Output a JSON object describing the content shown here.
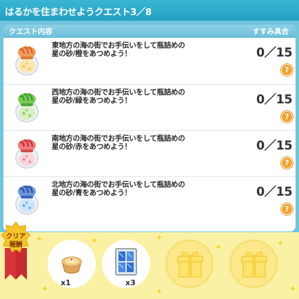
{
  "title": "はるかを住まわせようクエスト3／8",
  "panel": {
    "header_left": "クエスト内容",
    "header_right": "すすみ具合"
  },
  "quests": [
    {
      "text": "東地方の海の街でお手伝いをして瓶詰めの星の砂/橙をあつめよう！",
      "progress": "0／15",
      "jar_color": "#f29b5c",
      "stripe_color": "#d96a2c",
      "star_color": "#f7d84a"
    },
    {
      "text": "西地方の海の街でお手伝いをして瓶詰めの星の砂/緑をあつめよう！",
      "progress": "0／15",
      "jar_color": "#7ccc5a",
      "stripe_color": "#3f9d2f",
      "star_color": "#a8e07a"
    },
    {
      "text": "南地方の海の街でお手伝いをして瓶詰めの星の砂/赤をあつめよう！",
      "progress": "0／15",
      "jar_color": "#ef7b7b",
      "stripe_color": "#c9343a",
      "star_color": "#f7a3b0"
    },
    {
      "text": "北地方の海の街でお手伝いをして瓶詰めの星の砂/青をあつめよう！",
      "progress": "0／15",
      "jar_color": "#6f94d8",
      "stripe_color": "#2c54a8",
      "star_color": "#6ab0ee"
    }
  ],
  "help_label": "?",
  "reward": {
    "badge_line1": "クリア",
    "badge_line2": "報酬",
    "items": [
      {
        "count": "x1",
        "icon": "pudding-tart-icon"
      },
      {
        "count": "x3",
        "icon": "blue-tile-icon"
      },
      {
        "count": "",
        "icon": "gift-box-icon"
      },
      {
        "count": "",
        "icon": "gift-box-icon"
      }
    ]
  },
  "colors": {
    "frame": "#6fc6dc",
    "title_bar": "#249fc2",
    "reward_bg": "#fbf1a4",
    "help": "#f3a22c"
  }
}
